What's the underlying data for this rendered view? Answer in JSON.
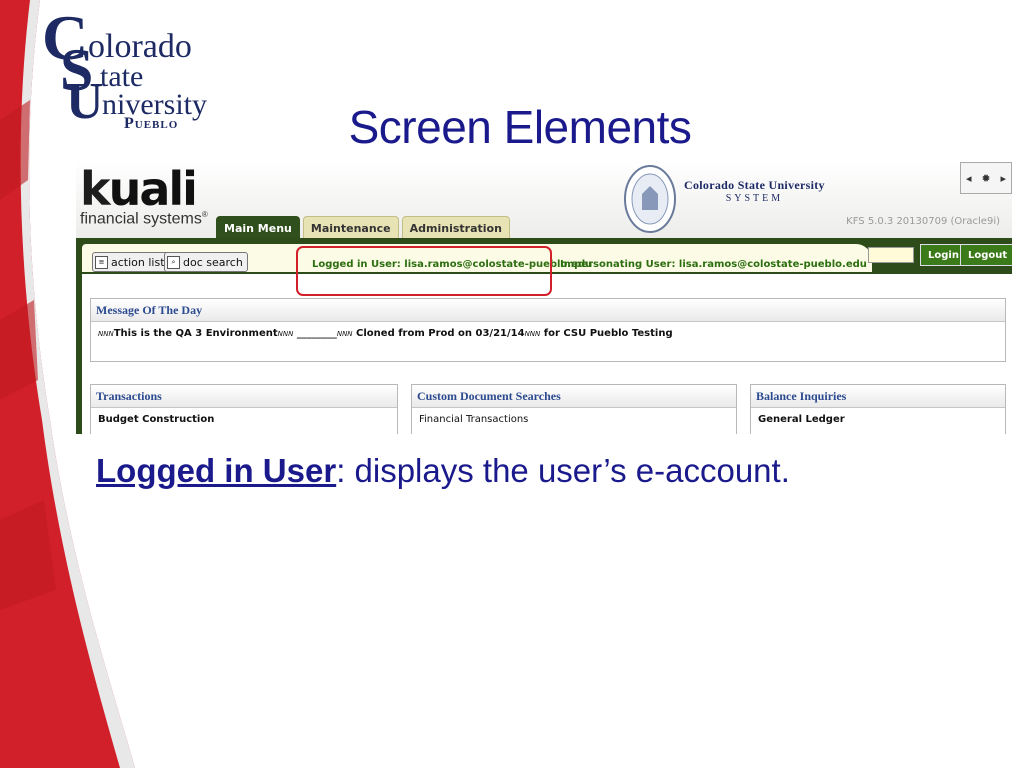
{
  "slide": {
    "title": "Screen Elements",
    "caption_term": "Logged in User",
    "caption_text": ": displays the user’s e-account."
  },
  "logo": {
    "big_c": "C",
    "big_s": "S",
    "big_u": "U",
    "word1": "olorado",
    "word2": "tate",
    "word3": "niversity",
    "word4": "Pueblo"
  },
  "kfs": {
    "brand_main": "uali",
    "brand_k": "k",
    "brand_sub": "financial systems",
    "tabs": [
      {
        "label": "Main Menu"
      },
      {
        "label": "Maintenance"
      },
      {
        "label": "Administration"
      }
    ],
    "csus_name": "Colorado State University",
    "csus_system": "SYSTEM",
    "version": "KFS 5.0.3 20130709 (Oracle9i)",
    "action_list": "action list",
    "doc_search": "doc search",
    "logged_in_user": "Logged in User: lisa.ramos@colostate-pueblo.edu",
    "impersonating_user": "Impersonating User: lisa.ramos@colostate-pueblo.edu",
    "login_label": "Login",
    "logout_label": "Logout",
    "motd_title": "Message Of The Day",
    "motd_text": "This is the QA 3 Environment",
    "motd_blank": "________",
    "motd_tail": " Cloned from Prod on 03/21/14",
    "motd_end": " for CSU Pueblo Testing",
    "motd_mark": "NNN",
    "panels": [
      {
        "title": "Transactions",
        "first_item": "Budget Construction"
      },
      {
        "title": "Custom Document Searches",
        "first_item": "Financial Transactions"
      },
      {
        "title": "Balance Inquiries",
        "first_item": "General Ledger"
      }
    ]
  },
  "colors": {
    "brand_blue": "#1a1a8c",
    "csu_red": "#d2202a",
    "kfs_green": "#2e4c1a"
  }
}
